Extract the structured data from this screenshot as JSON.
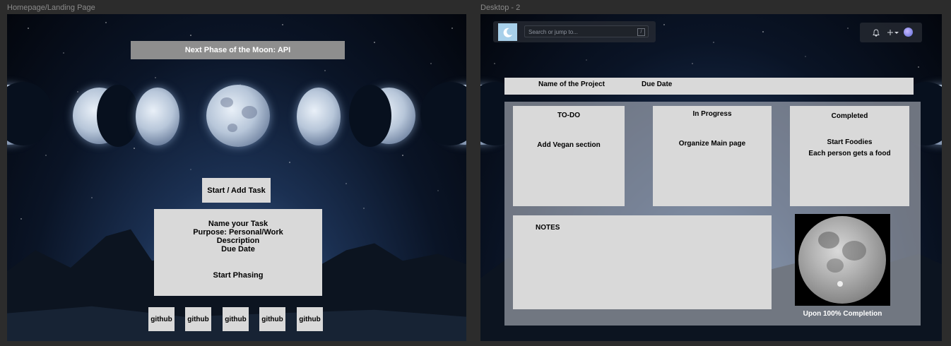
{
  "frames": {
    "left_label": "Homepage/Landing Page",
    "right_label": "Desktop - 2"
  },
  "landing": {
    "banner": "Next Phase of the Moon: API",
    "start_button": "Start / Add Task",
    "task_form": {
      "name": "Name your Task",
      "purpose": "Purpose: Personal/Work",
      "description": "Description",
      "due_date": "Due Date",
      "submit": "Start Phasing"
    },
    "github_links": [
      "github",
      "github",
      "github",
      "github",
      "github"
    ]
  },
  "desktop": {
    "search_placeholder": "Search or jump to...",
    "search_shortcut": "/",
    "project_name": "Name of the Project",
    "due_date": "Due Date",
    "columns": {
      "todo": {
        "title": "TO-DO",
        "items": [
          "Add Vegan section"
        ]
      },
      "progress": {
        "title": "In Progress",
        "items": [
          "Organize Main page"
        ]
      },
      "completed": {
        "title": "Completed",
        "items": [
          "Start Foodies",
          "Each person gets a food"
        ]
      }
    },
    "notes_title": "NOTES",
    "completion_caption": "Upon 100% Completion"
  },
  "colors": {
    "card": "#d9d9d9",
    "banner": "#8e8e8e",
    "logo": "#a8d0ea",
    "canvas": "#2c2c2c"
  },
  "icons": [
    "moon-icon",
    "bell-icon",
    "plus-icon",
    "chevron-down-icon",
    "avatar"
  ]
}
